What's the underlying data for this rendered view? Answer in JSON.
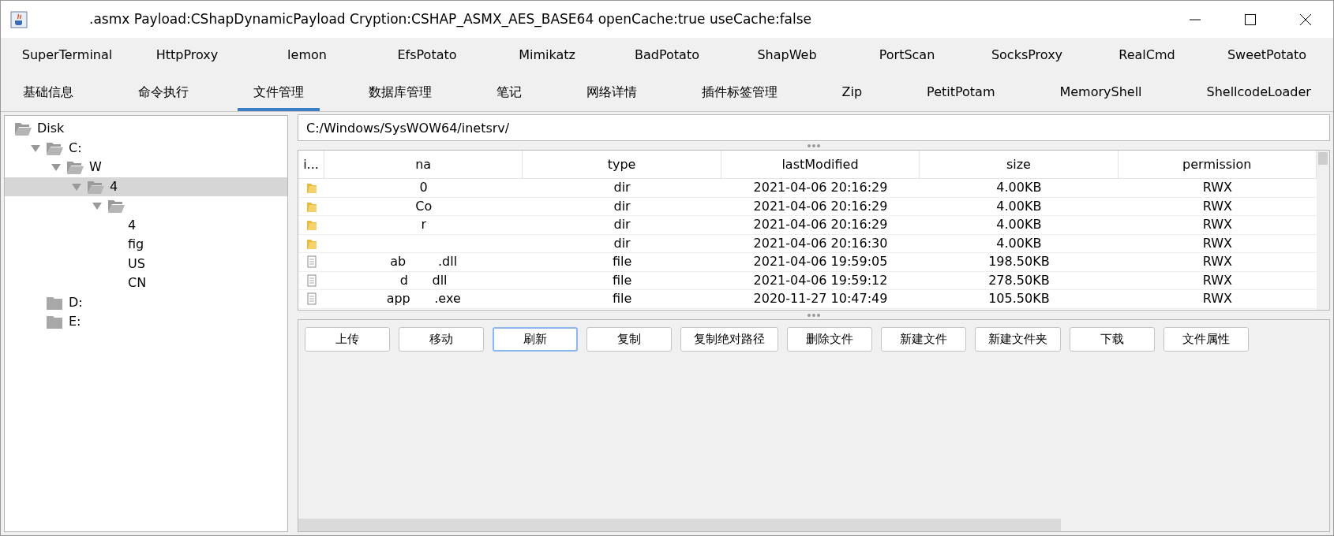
{
  "window": {
    "title": ".asmx Payload:CShapDynamicPayload Cryption:CSHAP_ASMX_AES_BASE64 openCache:true useCache:false"
  },
  "plugins": [
    {
      "label": "SuperTerminal"
    },
    {
      "label": "HttpProxy"
    },
    {
      "label": "lemon"
    },
    {
      "label": "EfsPotato"
    },
    {
      "label": "Mimikatz"
    },
    {
      "label": "BadPotato"
    },
    {
      "label": "ShapWeb"
    },
    {
      "label": "PortScan"
    },
    {
      "label": "SocksProxy"
    },
    {
      "label": "RealCmd"
    },
    {
      "label": "SweetPotato"
    }
  ],
  "tabs": [
    {
      "label": "基础信息",
      "selected": false
    },
    {
      "label": "命令执行",
      "selected": false
    },
    {
      "label": "文件管理",
      "selected": true
    },
    {
      "label": "数据库管理",
      "selected": false
    },
    {
      "label": "笔记",
      "selected": false
    },
    {
      "label": "网络详情",
      "selected": false
    },
    {
      "label": "插件标签管理",
      "selected": false
    },
    {
      "label": "Zip",
      "selected": false
    },
    {
      "label": "PetitPotam",
      "selected": false
    },
    {
      "label": "MemoryShell",
      "selected": false
    },
    {
      "label": "ShellcodeLoader",
      "selected": false
    }
  ],
  "tree": [
    {
      "label": "Disk",
      "kind": "root",
      "selected": false,
      "children": [
        {
          "label": "C:",
          "kind": "folder",
          "expanded": true,
          "selected": false,
          "children": [
            {
              "label": "W",
              "kind": "folder",
              "expanded": true,
              "selected": false,
              "children": [
                {
                  "label": "4",
                  "kind": "folder",
                  "expanded": true,
                  "selected": true,
                  "children": [
                    {
                      "kind": "folder",
                      "expanded": true,
                      "selected": false,
                      "children": [
                        {
                          "label": "4",
                          "selected": false
                        },
                        {
                          "label": "fig",
                          "selected": false
                        },
                        {
                          "label": "US",
                          "selected": false
                        },
                        {
                          "label": "CN",
                          "selected": false
                        }
                      ]
                    }
                  ]
                }
              ]
            }
          ]
        },
        {
          "label": "D:",
          "kind": "folder",
          "expanded": false,
          "selected": false
        },
        {
          "label": "E:",
          "kind": "folder",
          "expanded": false,
          "selected": false
        }
      ]
    }
  ],
  "path": {
    "value": "C:/Windows/SysWOW64/inetsrv/"
  },
  "table": {
    "columns": [
      "i...",
      "na",
      "type",
      "lastModified",
      "size",
      "permission"
    ],
    "rows": [
      {
        "kind": "folder",
        "name": "0",
        "type": "dir",
        "lastModified": "2021-04-06 20:16:29",
        "size": "4.00KB",
        "permission": "RWX"
      },
      {
        "kind": "folder",
        "name": "Co",
        "type": "dir",
        "lastModified": "2021-04-06 20:16:29",
        "size": "4.00KB",
        "permission": "RWX"
      },
      {
        "kind": "folder",
        "name": "r",
        "type": "dir",
        "lastModified": "2021-04-06 20:16:29",
        "size": "4.00KB",
        "permission": "RWX"
      },
      {
        "kind": "folder",
        "type": "dir",
        "lastModified": "2021-04-06 20:16:30",
        "size": "4.00KB",
        "permission": "RWX"
      },
      {
        "kind": "file",
        "name": "ab        .dll",
        "type": "file",
        "lastModified": "2021-04-06 19:59:05",
        "size": "198.50KB",
        "permission": "RWX"
      },
      {
        "kind": "file",
        "name": "d      dll",
        "type": "file",
        "lastModified": "2021-04-06 19:59:12",
        "size": "278.50KB",
        "permission": "RWX"
      },
      {
        "kind": "file",
        "name": "app      .exe",
        "type": "file",
        "lastModified": "2020-11-27 10:47:49",
        "size": "105.50KB",
        "permission": "RWX"
      }
    ]
  },
  "actions": [
    {
      "label": "上传",
      "focused": false
    },
    {
      "label": "移动",
      "focused": false
    },
    {
      "label": "刷新",
      "focused": true
    },
    {
      "label": "复制",
      "focused": false
    },
    {
      "label": "复制绝对路径",
      "focused": false
    },
    {
      "label": "删除文件",
      "focused": false
    },
    {
      "label": "新建文件",
      "focused": false
    },
    {
      "label": "新建文件夹",
      "focused": false
    },
    {
      "label": "下载",
      "focused": false
    },
    {
      "label": "文件属性",
      "focused": false
    }
  ]
}
